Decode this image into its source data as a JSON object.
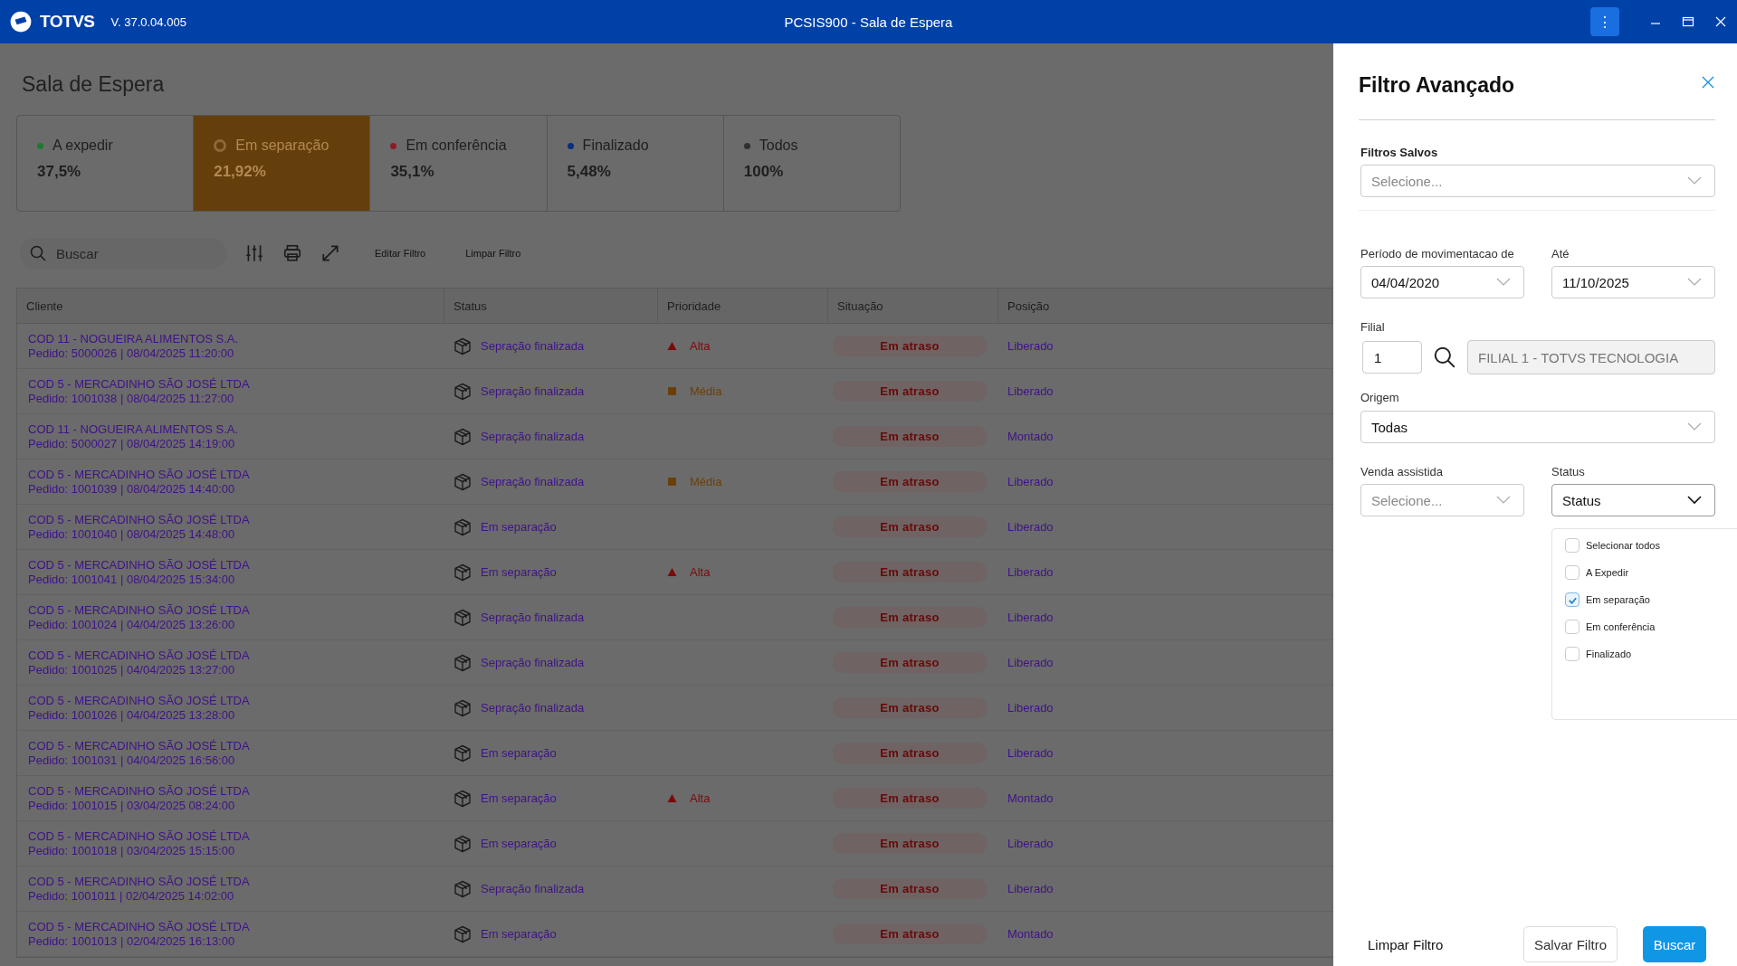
{
  "titlebar": {
    "brand": "TOTVS",
    "version": "V. 37.0.04.005",
    "title": "PCSIS900 - Sala de Espera",
    "menu_glyph": "⋮"
  },
  "page_title": "Sala de Espera",
  "status_cards": [
    {
      "label": "A expedir",
      "value": "37,5%",
      "color": "#1e7a32",
      "selected": false
    },
    {
      "label": "Em separação",
      "value": "21,92%",
      "color": "#8a6a3a",
      "selected": true
    },
    {
      "label": "Em conferência",
      "value": "35,1%",
      "color": "#8a1c2a",
      "selected": false
    },
    {
      "label": "Finalizado",
      "value": "5,48%",
      "color": "#0a2f7a",
      "selected": false
    },
    {
      "label": "Todos",
      "value": "100%",
      "color": "#303030",
      "selected": false
    }
  ],
  "toolbar": {
    "search_placeholder": "Buscar",
    "edit_filter": "Editar Filtro",
    "clear_filter": "Limpar Filtro"
  },
  "table": {
    "columns": [
      "Cliente",
      "Status",
      "Prioridade",
      "Situação",
      "Posição"
    ],
    "rows": [
      {
        "client": "COD 11 - NOGUEIRA ALIMENTOS S.A.",
        "order": "Pedido: 5000026 | 08/04/2025 11:20:00",
        "status": "Sepração finalizada",
        "priority": {
          "kind": "high",
          "label": "Alta"
        },
        "situation": "Em atraso",
        "position": "Liberado"
      },
      {
        "client": "COD 5 - MERCADINHO SÃO JOSÉ LTDA",
        "order": "Pedido: 1001038 | 08/04/2025 11:27:00",
        "status": "Sepração finalizada",
        "priority": {
          "kind": "medium",
          "label": "Média"
        },
        "situation": "Em atraso",
        "position": "Liberado"
      },
      {
        "client": "COD 11 - NOGUEIRA ALIMENTOS S.A.",
        "order": "Pedido: 5000027 | 08/04/2025 14:19:00",
        "status": "Sepração finalizada",
        "situation": "Em atraso",
        "position": "Montado"
      },
      {
        "client": "COD 5 - MERCADINHO SÃO JOSÉ LTDA",
        "order": "Pedido: 1001039 | 08/04/2025 14:40:00",
        "status": "Sepração finalizada",
        "priority": {
          "kind": "medium",
          "label": "Média"
        },
        "situation": "Em atraso",
        "position": "Liberado"
      },
      {
        "client": "COD 5 - MERCADINHO SÃO JOSÉ LTDA",
        "order": "Pedido: 1001040 | 08/04/2025 14:48:00",
        "status": "Em separação",
        "situation": "Em atraso",
        "position": "Liberado"
      },
      {
        "client": "COD 5 - MERCADINHO SÃO JOSÉ LTDA",
        "order": "Pedido: 1001041 | 08/04/2025 15:34:00",
        "status": "Em separação",
        "priority": {
          "kind": "high",
          "label": "Alta"
        },
        "situation": "Em atraso",
        "position": "Liberado"
      },
      {
        "client": "COD 5 - MERCADINHO SÃO JOSÉ LTDA",
        "order": "Pedido: 1001024 | 04/04/2025 13:26:00",
        "status": "Sepração finalizada",
        "situation": "Em atraso",
        "position": "Liberado"
      },
      {
        "client": "COD 5 - MERCADINHO SÃO JOSÉ LTDA",
        "order": "Pedido: 1001025 | 04/04/2025 13:27:00",
        "status": "Sepração finalizada",
        "situation": "Em atraso",
        "position": "Liberado"
      },
      {
        "client": "COD 5 - MERCADINHO SÃO JOSÉ LTDA",
        "order": "Pedido: 1001026 | 04/04/2025 13:28:00",
        "status": "Sepração finalizada",
        "situation": "Em atraso",
        "position": "Liberado"
      },
      {
        "client": "COD 5 - MERCADINHO SÃO JOSÉ LTDA",
        "order": "Pedido: 1001031 | 04/04/2025 16:56:00",
        "status": "Em separação",
        "situation": "Em atraso",
        "position": "Liberado"
      },
      {
        "client": "COD 5 - MERCADINHO SÃO JOSÉ LTDA",
        "order": "Pedido: 1001015 | 03/04/2025 08:24:00",
        "status": "Em separação",
        "priority": {
          "kind": "high",
          "label": "Alta"
        },
        "situation": "Em atraso",
        "position": "Montado"
      },
      {
        "client": "COD 5 - MERCADINHO SÃO JOSÉ LTDA",
        "order": "Pedido: 1001018 | 03/04/2025 15:15:00",
        "status": "Em separação",
        "situation": "Em atraso",
        "position": "Liberado"
      },
      {
        "client": "COD 5 - MERCADINHO SÃO JOSÉ LTDA",
        "order": "Pedido: 1001011 | 02/04/2025 14:02:00",
        "status": "Sepração finalizada",
        "situation": "Em atraso",
        "position": "Liberado"
      },
      {
        "client": "COD 5 - MERCADINHO SÃO JOSÉ LTDA",
        "order": "Pedido: 1001013 | 02/04/2025 16:13:00",
        "status": "Em separação",
        "situation": "Em atraso",
        "position": "Montado"
      }
    ]
  },
  "filter_panel": {
    "title": "Filtro Avançado",
    "saved_filters": {
      "label": "Filtros Salvos",
      "placeholder": "Selecione..."
    },
    "period_from": {
      "label": "Período de movimentacao  de",
      "value": "04/04/2020"
    },
    "period_to": {
      "label": "Até",
      "value": "11/10/2025"
    },
    "branch": {
      "label": "Filial",
      "code": "1",
      "name": "FILIAL 1 - TOTVS TECNOLOGIA"
    },
    "origin": {
      "label": "Origem",
      "value": "Todas"
    },
    "assisted_sale": {
      "label": "Venda assistida",
      "placeholder": "Selecione..."
    },
    "status": {
      "label": "Status",
      "value": "Status",
      "options": [
        {
          "label": "Selecionar todos",
          "checked": false
        },
        {
          "label": "A Expedir",
          "checked": false
        },
        {
          "label": "Em separação",
          "checked": true
        },
        {
          "label": "Em conferência",
          "checked": false
        },
        {
          "label": "Finalizado",
          "checked": false
        }
      ]
    },
    "buttons": {
      "clear": "Limpar Filtro",
      "save": "Salvar Filtro",
      "search": "Buscar"
    }
  }
}
